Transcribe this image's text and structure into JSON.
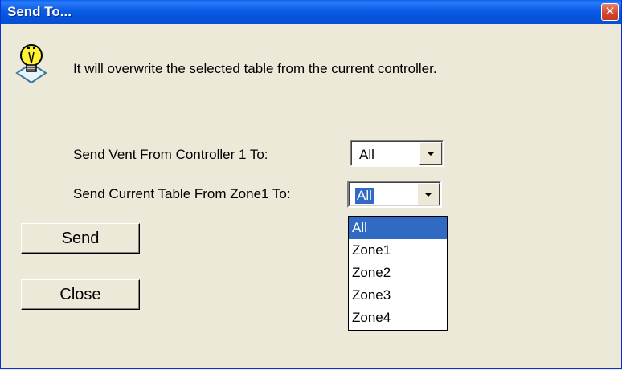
{
  "window": {
    "title": "Send To..."
  },
  "titlebar": {
    "close_glyph": "✕"
  },
  "dialog": {
    "icon": "info-lightbulb-icon",
    "message": "It will overwrite the selected table from the current controller."
  },
  "vent": {
    "label": "Send Vent From Controller 1 To:",
    "selected": "All"
  },
  "table": {
    "label": "Send Current Table From Zone1 To:",
    "selected": "All",
    "options": [
      "All",
      "Zone1",
      "Zone2",
      "Zone3",
      "Zone4"
    ],
    "highlighted_option": "All"
  },
  "buttons": {
    "send_label": "Send",
    "close_label": "Close"
  },
  "colors": {
    "selection": "#316ac5",
    "titlebar": "#0a5be6",
    "dialog_bg": "#ece9d8"
  }
}
